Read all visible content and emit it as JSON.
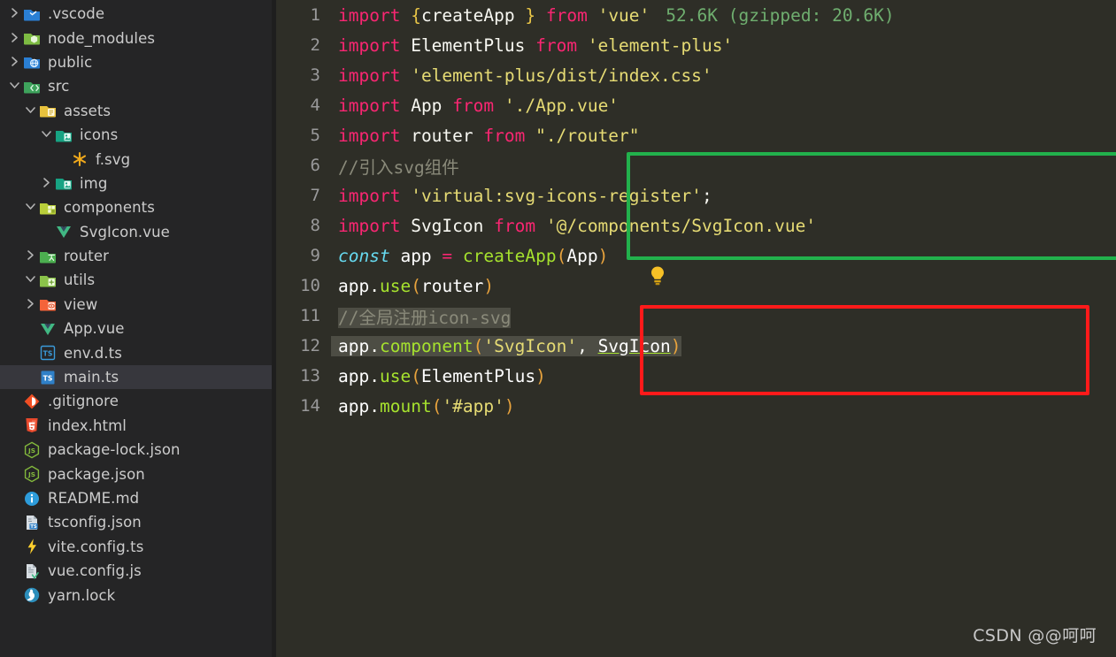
{
  "window": {
    "theme_editor_bg": "#2e2e27",
    "theme_sidebar_bg": "#252526",
    "accent_green_box": "#22b14c",
    "accent_red_box": "#ff1a1a"
  },
  "sidebar": {
    "items": [
      {
        "label": ".vscode",
        "indent": 0,
        "twisty": "chevron-right",
        "icon": "vscode-folder-icon",
        "selected": false
      },
      {
        "label": "node_modules",
        "indent": 0,
        "twisty": "chevron-right",
        "icon": "node-folder-icon",
        "selected": false
      },
      {
        "label": "public",
        "indent": 0,
        "twisty": "chevron-right",
        "icon": "public-folder-icon",
        "selected": false
      },
      {
        "label": "src",
        "indent": 0,
        "twisty": "chevron-down",
        "icon": "src-folder-icon",
        "selected": false
      },
      {
        "label": "assets",
        "indent": 1,
        "twisty": "chevron-down",
        "icon": "assets-folder-icon",
        "selected": false
      },
      {
        "label": "icons",
        "indent": 2,
        "twisty": "chevron-down",
        "icon": "images-folder-icon",
        "selected": false
      },
      {
        "label": "f.svg",
        "indent": 3,
        "twisty": "none",
        "icon": "svg-file-icon",
        "selected": false
      },
      {
        "label": "img",
        "indent": 2,
        "twisty": "chevron-right",
        "icon": "images-folder-icon",
        "selected": false
      },
      {
        "label": "components",
        "indent": 1,
        "twisty": "chevron-down",
        "icon": "components-folder-icon",
        "selected": false
      },
      {
        "label": "SvgIcon.vue",
        "indent": 2,
        "twisty": "none",
        "icon": "vue-file-icon",
        "selected": false
      },
      {
        "label": "router",
        "indent": 1,
        "twisty": "chevron-right",
        "icon": "router-folder-icon",
        "selected": false
      },
      {
        "label": "utils",
        "indent": 1,
        "twisty": "chevron-down",
        "icon": "utils-folder-icon",
        "selected": false
      },
      {
        "label": "view",
        "indent": 1,
        "twisty": "chevron-right",
        "icon": "view-folder-icon",
        "selected": false
      },
      {
        "label": "App.vue",
        "indent": 1,
        "twisty": "none",
        "icon": "vue-file-icon",
        "selected": false
      },
      {
        "label": "env.d.ts",
        "indent": 1,
        "twisty": "none",
        "icon": "ts-def-file-icon",
        "selected": false
      },
      {
        "label": "main.ts",
        "indent": 1,
        "twisty": "none",
        "icon": "ts-file-icon",
        "selected": true
      },
      {
        "label": ".gitignore",
        "indent": 0,
        "twisty": "none",
        "icon": "git-file-icon",
        "selected": false
      },
      {
        "label": "index.html",
        "indent": 0,
        "twisty": "none",
        "icon": "html-file-icon",
        "selected": false
      },
      {
        "label": "package-lock.json",
        "indent": 0,
        "twisty": "none",
        "icon": "npm-lock-file-icon",
        "selected": false
      },
      {
        "label": "package.json",
        "indent": 0,
        "twisty": "none",
        "icon": "npm-file-icon",
        "selected": false
      },
      {
        "label": "README.md",
        "indent": 0,
        "twisty": "none",
        "icon": "readme-info-icon",
        "selected": false
      },
      {
        "label": "tsconfig.json",
        "indent": 0,
        "twisty": "none",
        "icon": "tsconfig-file-icon",
        "selected": false
      },
      {
        "label": "vite.config.ts",
        "indent": 0,
        "twisty": "none",
        "icon": "vite-file-icon",
        "selected": false
      },
      {
        "label": "vue.config.js",
        "indent": 0,
        "twisty": "none",
        "icon": "vue-config-file-icon",
        "selected": false
      },
      {
        "label": "yarn.lock",
        "indent": 0,
        "twisty": "none",
        "icon": "yarn-file-icon",
        "selected": false
      }
    ]
  },
  "editor": {
    "file": "main.ts",
    "import_size_annotation": "52.6K (gzipped: 20.6K)",
    "lines": [
      {
        "n": "1",
        "text": "import { createApp } from 'vue'"
      },
      {
        "n": "2",
        "text": "import ElementPlus from 'element-plus'"
      },
      {
        "n": "3",
        "text": "import 'element-plus/dist/index.css'"
      },
      {
        "n": "4",
        "text": "import App from './App.vue'"
      },
      {
        "n": "5",
        "text": "import router from \"./router\""
      },
      {
        "n": "6",
        "text": "//引入svg组件"
      },
      {
        "n": "7",
        "text": "import 'virtual:svg-icons-register';"
      },
      {
        "n": "8",
        "text": "import SvgIcon from '@/components/SvgIcon.vue'"
      },
      {
        "n": "9",
        "text": "const app = createApp(App)"
      },
      {
        "n": "10",
        "text": "app.use(router)"
      },
      {
        "n": "11",
        "text": "//全局注册icon-svg"
      },
      {
        "n": "12",
        "text": "app.component('SvgIcon', SvgIcon)"
      },
      {
        "n": "13",
        "text": "app.use(ElementPlus)"
      },
      {
        "n": "14",
        "text": "app.mount('#app')"
      }
    ],
    "tokens": {
      "kw_import": "import",
      "kw_from": "from",
      "kw_const": "const",
      "ident_createApp": "createApp",
      "ident_ElementPlus": "ElementPlus",
      "ident_App": "App",
      "ident_router": "router",
      "ident_SvgIcon": "SvgIcon",
      "ident_app": "app",
      "fn_use": "use",
      "fn_component": "component",
      "fn_mount": "mount",
      "str_vue": "'vue'",
      "str_element_plus": "'element-plus'",
      "str_element_css": "'element-plus/dist/index.css'",
      "str_app_vue": "'./App.vue'",
      "str_router": "\"./router\"",
      "str_virtual": "'virtual:svg-icons-register'",
      "str_svgicon_path": "'@/components/SvgIcon.vue'",
      "str_svgicon_name": "'SvgIcon'",
      "str_app_sel": "'#app'",
      "comment_svg": "//引入svg组件",
      "comment_register": "//全局注册icon-svg"
    },
    "quickfix_icon": "lightbulb-icon",
    "error_marker_title": "error-marker"
  },
  "watermark": {
    "text": "CSDN @@呵呵"
  }
}
